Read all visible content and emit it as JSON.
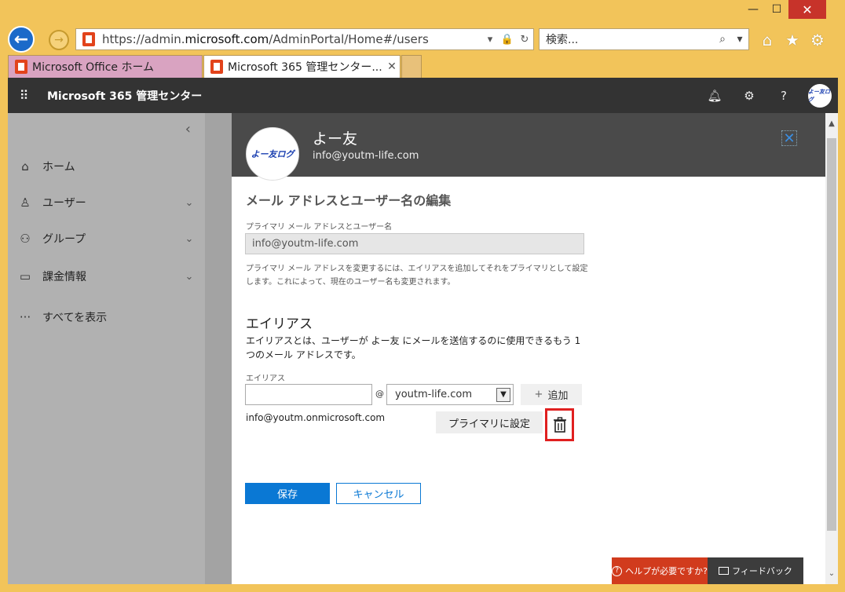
{
  "browser": {
    "url_prefix": "https://admin.",
    "url_domain": "microsoft.com",
    "url_path": "/AdminPortal/Home#/users",
    "search_placeholder": "検索...",
    "tabs": [
      {
        "label": "Microsoft Office ホーム"
      },
      {
        "label": "Microsoft 365 管理センター..."
      }
    ],
    "window_controls": {
      "minimize": "—",
      "maximize": "☐",
      "close": "✕"
    }
  },
  "app": {
    "title": "Microsoft 365 管理センター",
    "avatar_text": "よー友ログ"
  },
  "nav": {
    "items": [
      {
        "label": "ホーム",
        "icon": "home-icon",
        "glyph": "⌂"
      },
      {
        "label": "ユーザー",
        "icon": "user-icon",
        "glyph": "♙"
      },
      {
        "label": "グループ",
        "icon": "group-icon",
        "glyph": "⚇"
      },
      {
        "label": "課金情報",
        "icon": "billing-icon",
        "glyph": "▭"
      },
      {
        "label": "すべてを表示",
        "icon": "more-icon",
        "glyph": "···"
      }
    ]
  },
  "panel": {
    "user_name": "よー友",
    "user_email": "info@youtm-life.com",
    "avatar_text": "よー友ログ",
    "section_title": "メール アドレスとユーザー名の編集",
    "primary_label": "プライマリ メール アドレスとユーザー名",
    "primary_value": "info@youtm-life.com",
    "help_text": "プライマリ メール アドレスを変更するには、エイリアスを追加してそれをプライマリとして設定します。これによって、現在のユーザー名も変更されます。",
    "alias_title": "エイリアス",
    "alias_desc": "エイリアスとは、ユーザーが よー友 にメールを送信するのに使用できるもう 1 つのメール アドレスです。",
    "alias_label": "エイリアス",
    "alias_input_value": "",
    "at_sign": "@",
    "domain_selected": "youtm-life.com",
    "add_label": "追加",
    "existing_alias": "info@youtm.onmicrosoft.com",
    "set_primary_label": "プライマリに設定",
    "save_label": "保存",
    "cancel_label": "キャンセル"
  },
  "footer": {
    "help_label": "ヘルプが必要ですか?",
    "feedback_label": "フィードバック"
  },
  "colors": {
    "accent": "#0a78d4",
    "highlight": "#e02020",
    "help_bg": "#d13b1d"
  }
}
